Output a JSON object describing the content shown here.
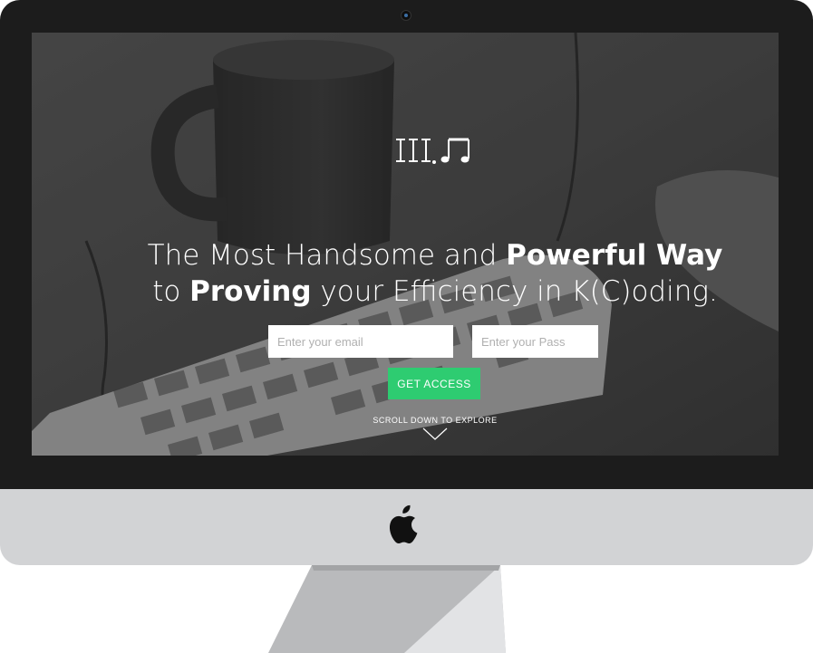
{
  "hero": {
    "headline_part1": "The Most Handsome and ",
    "headline_bold1": "Powerful Way",
    "headline_part2": "to ",
    "headline_bold2": "Proving",
    "headline_part3": " your Efficiency in K(C)oding."
  },
  "form": {
    "email_placeholder": "Enter your email",
    "pass_placeholder": "Enter your Pass",
    "cta_label": "GET ACCESS"
  },
  "scroll": {
    "label": "SCROLL DOWN TO EXPLORE"
  },
  "colors": {
    "accent": "#2ecc71",
    "bezel": "#1c1c1c",
    "chin": "#d2d3d5"
  },
  "icons": {
    "logo": "bars-music-note-logo",
    "brand": "apple-logo-icon",
    "scroll": "chevron-down-icon"
  }
}
